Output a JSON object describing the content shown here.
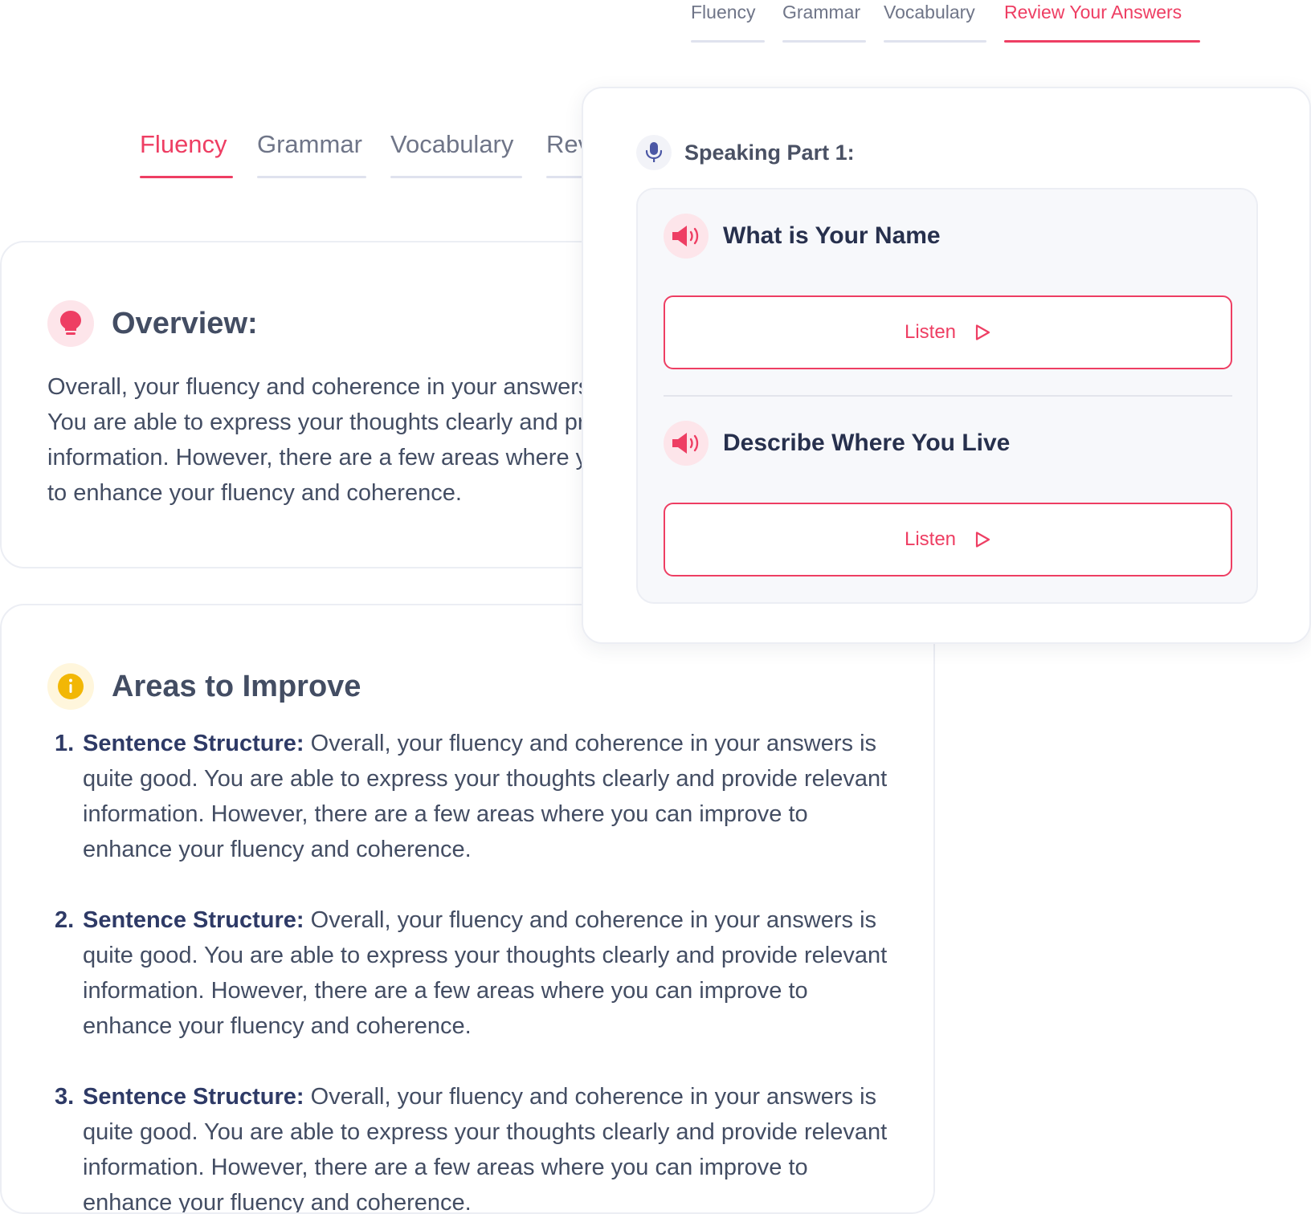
{
  "top_tabs": [
    "Fluency",
    "Grammar",
    "Vocabulary",
    "Review Your Answers"
  ],
  "main_tabs": [
    "Fluency",
    "Grammar",
    "Vocabulary",
    "Rev"
  ],
  "overview": {
    "title": "Overview:",
    "text": "Overall, your fluency and coherence in your answers is quite good. You are able to express your thoughts clearly and provide relevant information. However, there are a few areas where you can improve to enhance your fluency and coherence."
  },
  "improve": {
    "title": "Areas to Improve",
    "items": [
      {
        "num": "1.",
        "label": "Sentence Structure:",
        "text": " Overall, your fluency and coherence in your answers is quite good. You are able to express your thoughts clearly and provide relevant information. However, there are a few areas where you can improve to enhance your fluency and coherence."
      },
      {
        "num": "2.",
        "label": "Sentence Structure:",
        "text": " Overall, your fluency and coherence in your answers is quite good. You are able to express your thoughts clearly and provide relevant information. However, there are a few areas where you can improve to enhance your fluency and coherence."
      },
      {
        "num": "3.",
        "label": "Sentence Structure:",
        "text": " Overall, your fluency and coherence in your answers is quite good. You are able to express your thoughts clearly and provide relevant information. However, there are a few areas where you can improve to enhance your fluency and coherence."
      }
    ]
  },
  "popup": {
    "title": "Speaking Part 1:",
    "questions": [
      {
        "title": "What is Your Name",
        "button": "Listen"
      },
      {
        "title": "Describe Where You Live",
        "button": "Listen"
      }
    ]
  },
  "icons": {
    "overview": "lightbulb-icon",
    "improve": "info-icon",
    "popup": "microphone-icon",
    "question": "speaker-icon",
    "listen": "play-icon"
  },
  "colors": {
    "accent": "#ee3e63",
    "info": "#f2b705",
    "heading": "#434d63",
    "navy": "#2e3a66"
  }
}
